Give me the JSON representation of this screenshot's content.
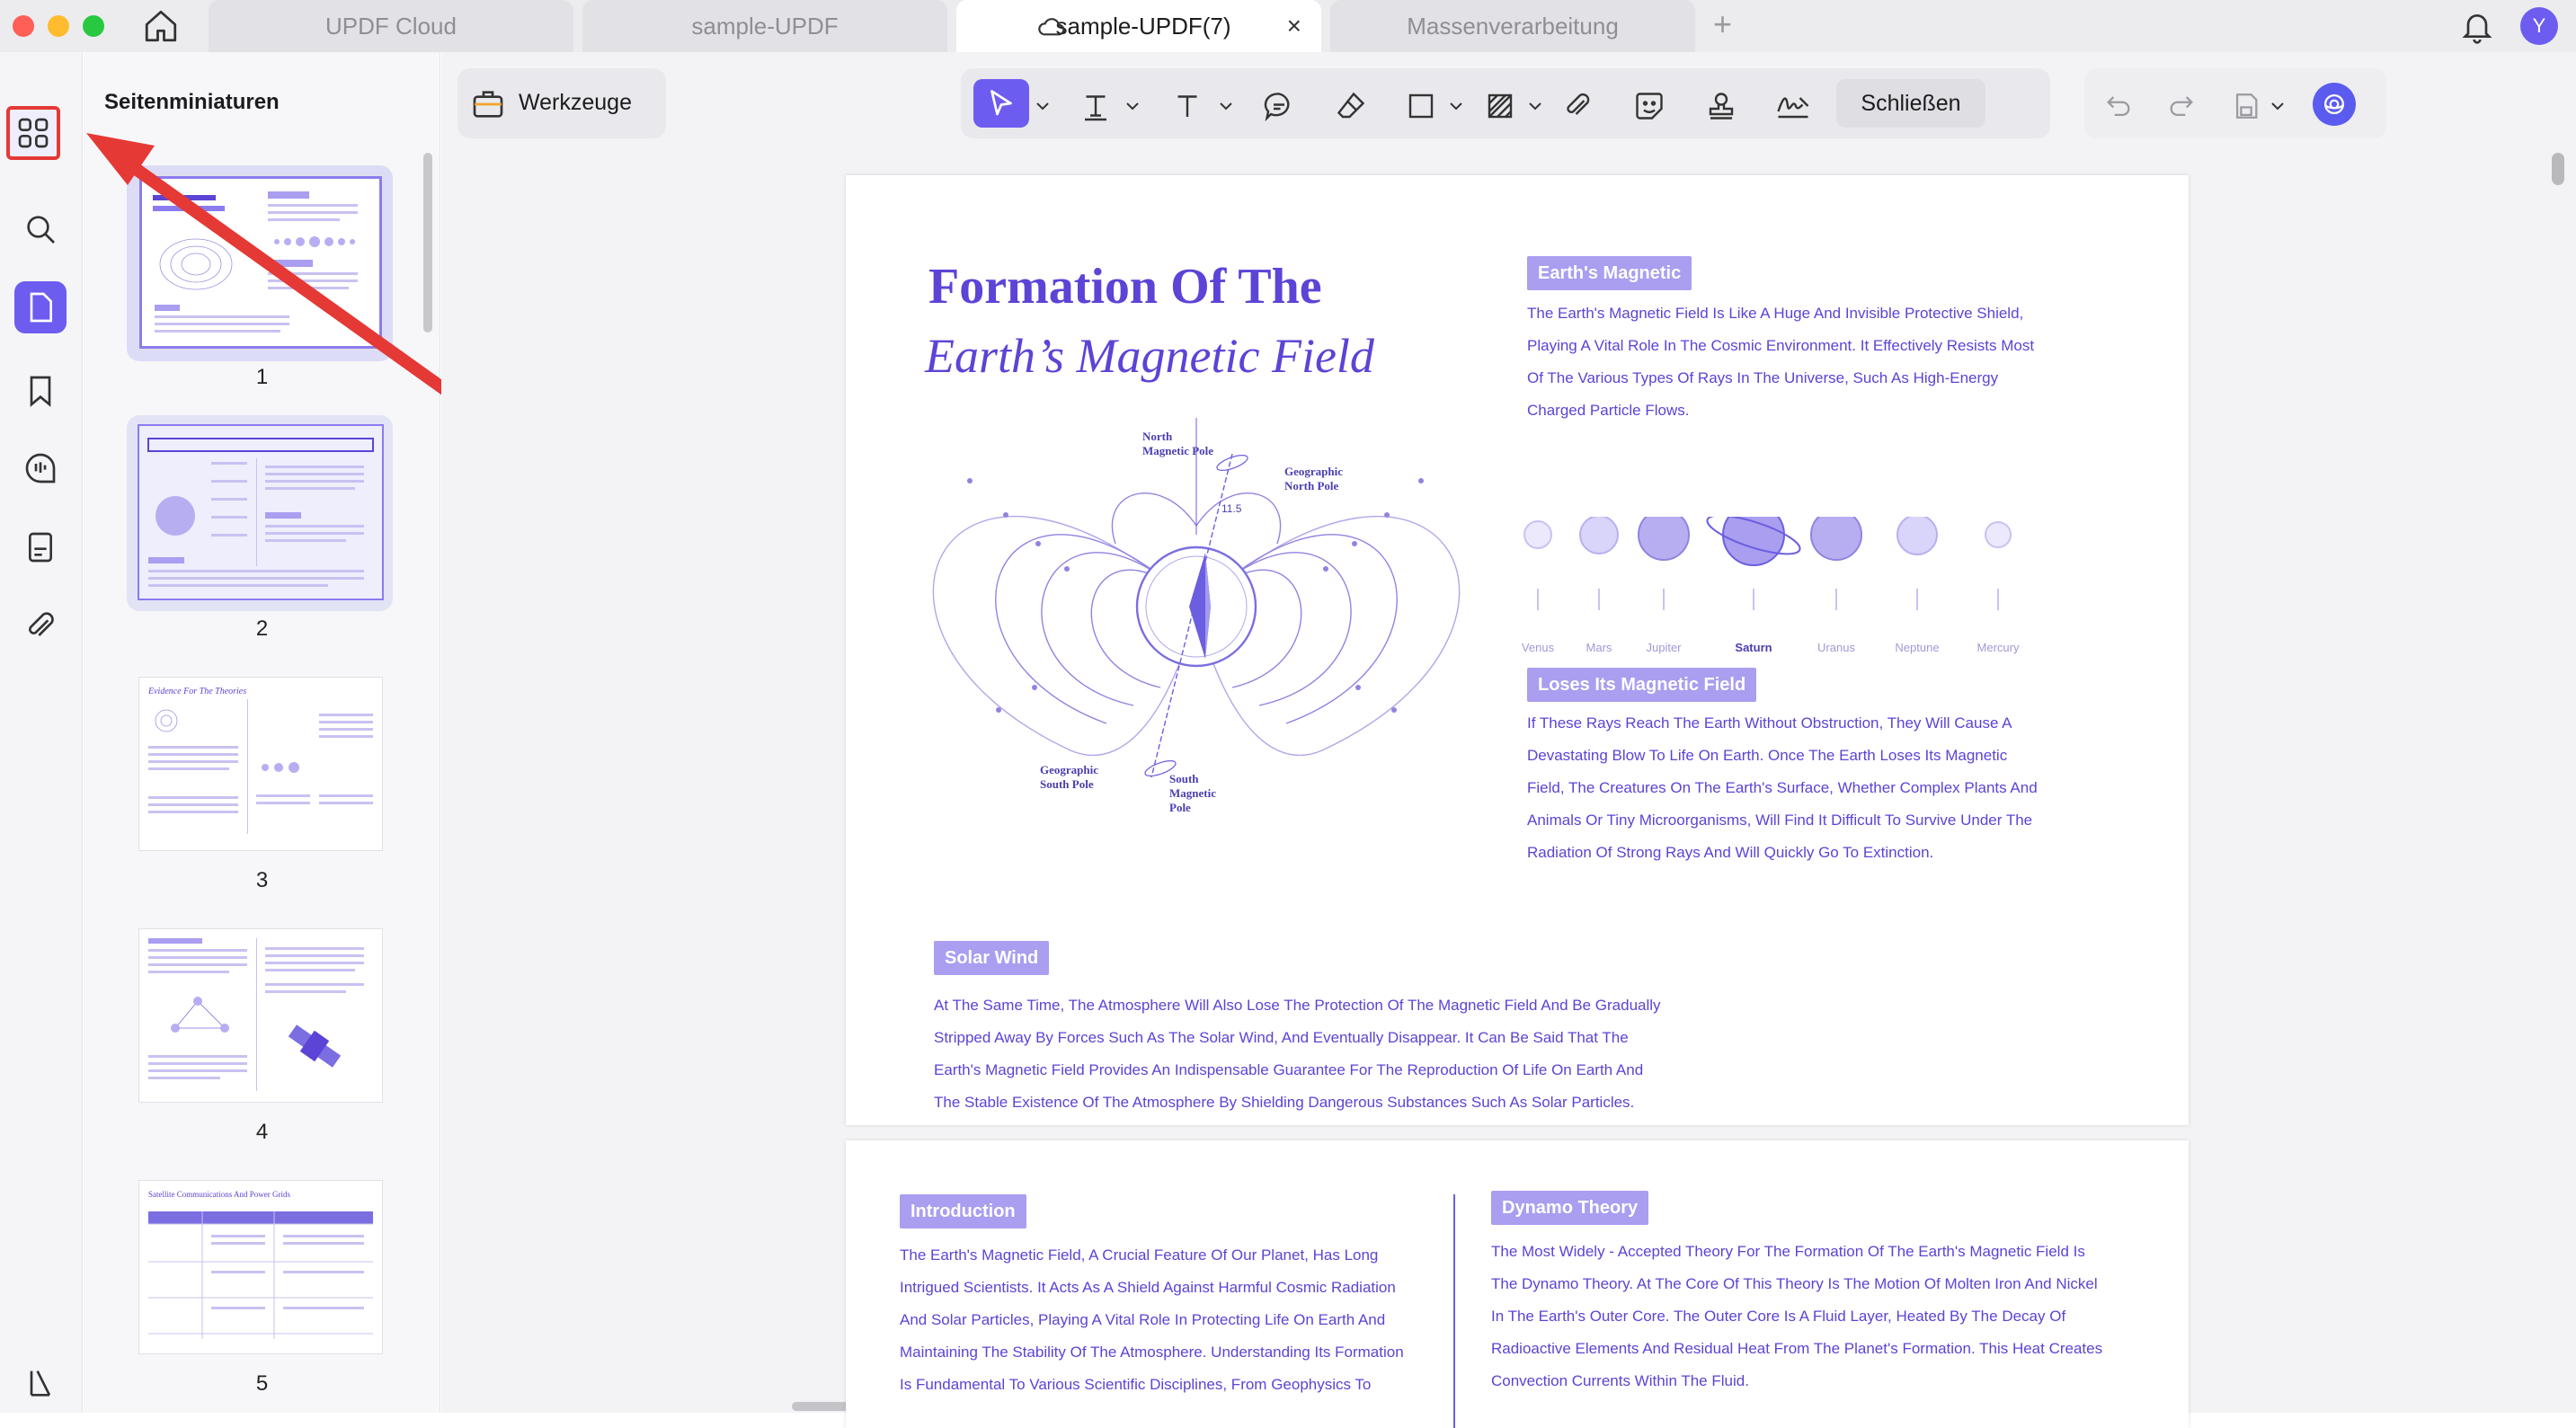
{
  "tabs": [
    {
      "label": "UPDF Cloud"
    },
    {
      "label": "sample-UPDF"
    },
    {
      "label": "sample-UPDF(7)"
    },
    {
      "label": "Massenverarbeitung"
    }
  ],
  "tab_close": "×",
  "tab_add": "+",
  "avatar_letter": "Y",
  "sidebar_title": "Seitenminiaturen",
  "tools_label": "Werkzeuge",
  "close_label": "Schließen",
  "thumbnails": [
    {
      "num": "1"
    },
    {
      "num": "2"
    },
    {
      "num": "3"
    },
    {
      "num": "4"
    },
    {
      "num": "5"
    }
  ],
  "thumb_text": {
    "t3_title": "Evidence For The Theories",
    "t5_title": "Satellite Communications And Power Grids"
  },
  "page1": {
    "title_line1": "Formation Of The",
    "title_line2": "Earth’s Magnetic Field",
    "diagram": {
      "north_magnetic_pole": [
        "North",
        "Magnetic Pole"
      ],
      "geographic_north_pole": [
        "Geographic",
        "North Pole"
      ],
      "angle": "11.5",
      "geographic_south_pole": [
        "Geographic",
        "South Pole"
      ],
      "south_magnetic_pole": [
        "South",
        "Magnetic",
        "Pole"
      ]
    },
    "earths_magnetic": {
      "heading": "Earth's Magnetic",
      "lines": [
        "The Earth's Magnetic Field Is Like A Huge And Invisible Protective Shield,",
        "Playing A Vital Role In The Cosmic Environment. It Effectively Resists Most",
        "Of The Various Types Of Rays In The Universe, Such As High-Energy",
        "Charged Particle Flows."
      ]
    },
    "planets": [
      "Venus",
      "Mars",
      "Jupiter",
      "Saturn",
      "Uranus",
      "Neptune",
      "Mercury"
    ],
    "loses": {
      "heading": "Loses Its Magnetic Field",
      "lines": [
        "If These Rays Reach The Earth Without Obstruction, They Will Cause A",
        "Devastating Blow To Life On Earth. Once The Earth Loses Its Magnetic",
        "Field, The Creatures On The Earth's Surface, Whether Complex Plants And",
        "Animals Or Tiny Microorganisms, Will Find It Difficult To Survive Under The",
        "Radiation Of Strong Rays And Will Quickly Go To Extinction."
      ]
    },
    "solar": {
      "heading": "Solar Wind",
      "lines": [
        "At The Same Time, The Atmosphere Will Also Lose The Protection Of The Magnetic Field And Be Gradually",
        "Stripped Away By Forces Such As The Solar Wind, And Eventually Disappear. It Can Be Said That The",
        "Earth's Magnetic Field Provides An Indispensable Guarantee For The Reproduction Of Life On Earth And",
        "The Stable Existence Of The Atmosphere By Shielding Dangerous Substances Such As Solar Particles."
      ]
    }
  },
  "page2": {
    "intro": {
      "heading": "Introduction",
      "lines": [
        "The Earth's Magnetic Field, A Crucial Feature Of Our Planet, Has Long",
        "Intrigued Scientists. It Acts As A Shield Against Harmful Cosmic Radiation",
        "And Solar Particles, Playing A Vital Role In Protecting Life On Earth And",
        "Maintaining The Stability Of The Atmosphere. Understanding Its Formation",
        "Is Fundamental To Various Scientific Disciplines, From Geophysics To"
      ]
    },
    "dynamo": {
      "heading": "Dynamo Theory",
      "lines": [
        "The Most Widely - Accepted Theory For The Formation Of The Earth's Magnetic Field Is",
        "The Dynamo Theory. At The Core Of This Theory Is The Motion Of Molten Iron And Nickel",
        "In The Earth's Outer Core. The Outer Core Is A Fluid Layer, Heated By The Decay Of",
        "Radioactive Elements And Residual Heat From The Planet's Formation. This Heat Creates",
        "Convection Currents Within The Fluid."
      ]
    }
  },
  "colors": {
    "accent": "#5b44d6",
    "badge": "#a99ef0",
    "rail_active": "#6d5cf0",
    "highlight_red": "#e53935"
  }
}
